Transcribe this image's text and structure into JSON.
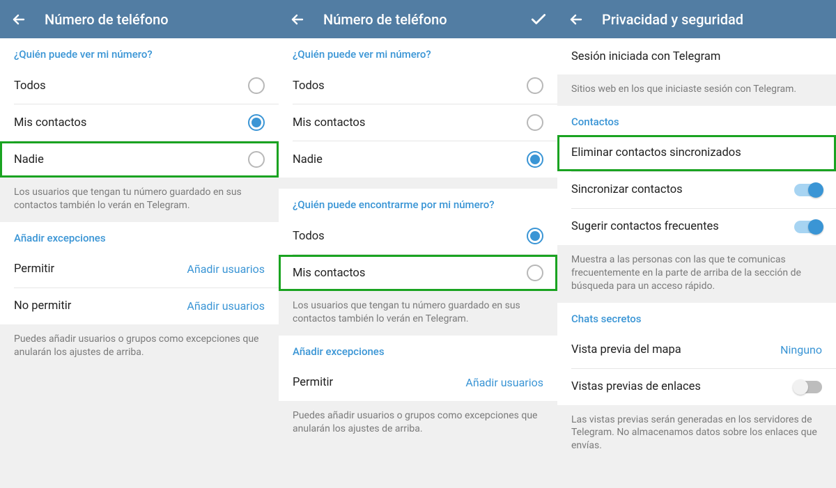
{
  "screen1": {
    "title": "Número de teléfono",
    "q1_header": "¿Quién puede ver mi número?",
    "opts": [
      {
        "label": "Todos",
        "checked": false
      },
      {
        "label": "Mis contactos",
        "checked": true
      },
      {
        "label": "Nadie",
        "checked": false,
        "highlight": true
      }
    ],
    "q1_note": "Los usuarios que tengan tu número guardado en sus contactos también lo verán en Telegram.",
    "exceptions_header": "Añadir excepciones",
    "exc": [
      {
        "label": "Permitir",
        "action": "Añadir usuarios"
      },
      {
        "label": "No permitir",
        "action": "Añadir usuarios"
      }
    ],
    "exc_note": "Puedes añadir usuarios o grupos como excepciones que anularán los ajustes de arriba."
  },
  "screen2": {
    "title": "Número de teléfono",
    "q1_header": "¿Quién puede ver mi número?",
    "opts1": [
      {
        "label": "Todos",
        "checked": false
      },
      {
        "label": "Mis contactos",
        "checked": false
      },
      {
        "label": "Nadie",
        "checked": true
      }
    ],
    "q2_header": "¿Quién puede encontrarme por mi número?",
    "opts2": [
      {
        "label": "Todos",
        "checked": true
      },
      {
        "label": "Mis contactos",
        "checked": false,
        "highlight": true
      }
    ],
    "q2_note": "Los usuarios que tengan tu número guardado en sus contactos también lo verán en Telegram.",
    "exceptions_header": "Añadir excepciones",
    "exc": [
      {
        "label": "Permitir",
        "action": "Añadir usuarios"
      }
    ],
    "exc_note": "Puedes añadir usuarios o grupos como excepciones que anularán los ajustes de arriba."
  },
  "screen3": {
    "title": "Privacidad y seguridad",
    "session_row": "Sesión iniciada con Telegram",
    "session_note": "Sitios web en los que iniciaste sesión con Telegram.",
    "contacts_header": "Contactos",
    "contacts_rows": {
      "delete_synced": "Eliminar contactos sincronizados",
      "sync": "Sincronizar contactos",
      "suggest": "Sugerir contactos frecuentes"
    },
    "contacts_note": "Muestra a las personas con las que te comunicas frecuentemente en la parte de arriba de la sección de búsqueda para un acceso rápido.",
    "secret_header": "Chats secretos",
    "map_row": {
      "label": "Vista previa del mapa",
      "value": "Ninguno"
    },
    "links_row": "Vistas previas de enlaces",
    "links_note": "Las vistas previas serán generadas en los servidores de Telegram. No almacenamos datos sobre los enlaces que envías."
  }
}
